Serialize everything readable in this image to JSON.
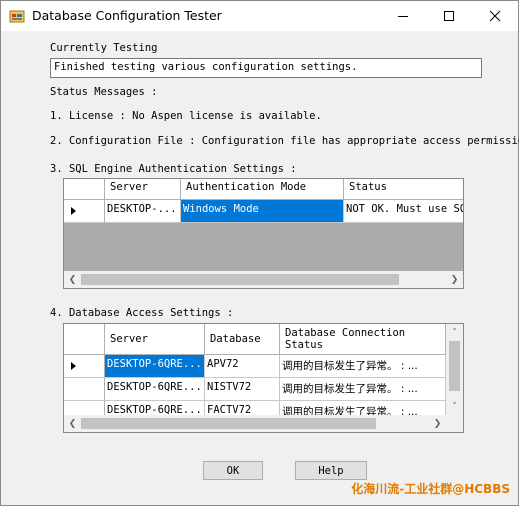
{
  "window": {
    "title": "Database Configuration Tester"
  },
  "currently_testing": {
    "label": "Currently Testing",
    "value": "Finished testing various configuration settings."
  },
  "status": {
    "heading": "Status Messages :",
    "messages": [
      "1. License : No Aspen license is available.",
      "2. Configuration File : Configuration file has appropriate access permissions."
    ]
  },
  "sql_auth": {
    "heading": "3. SQL Engine Authentication Settings :",
    "columns": [
      "Server",
      "Authentication Mode",
      "Status"
    ],
    "rows": [
      {
        "server": "DESKTOP-...",
        "mode": "Windows Mode",
        "status": "NOT OK. Must use SQL"
      }
    ]
  },
  "db_access": {
    "heading": "4. Database Access Settings :",
    "columns": [
      "Server",
      "Database",
      "Database Connection Status"
    ],
    "rows": [
      {
        "server": "DESKTOP-6QRE...",
        "database": "APV72",
        "status": "调用的目标发生了异常。 : ..."
      },
      {
        "server": "DESKTOP-6QRE...",
        "database": "NISTV72",
        "status": "调用的目标发生了异常。 : ..."
      },
      {
        "server": "DESKTOP-6QRE...",
        "database": "FACTV72",
        "status": "调用的目标发生了异常。 : ..."
      }
    ]
  },
  "buttons": {
    "ok": "OK",
    "help": "Help"
  },
  "watermark": "化海川流-工业社群@HCBBS",
  "colors": {
    "selection": "#0078d7",
    "grid_background": "#ababab",
    "watermark": "#e07b00"
  }
}
